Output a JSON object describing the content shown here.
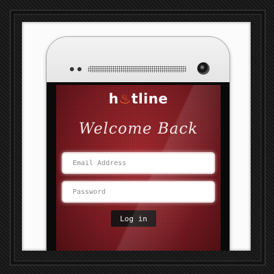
{
  "app": {
    "logo_prefix": "h",
    "logo_flame": "♨",
    "logo_suffix": "tline",
    "logo_flame_color": "#ff6a2b"
  },
  "login": {
    "heading": "Welcome Back",
    "email_placeholder": "Email Address",
    "password_placeholder": "Password",
    "button_label": "Log in"
  },
  "colors": {
    "screen_red": "#8b1f25",
    "button_dark": "#1a1414",
    "frame": "#1a1a1a"
  }
}
